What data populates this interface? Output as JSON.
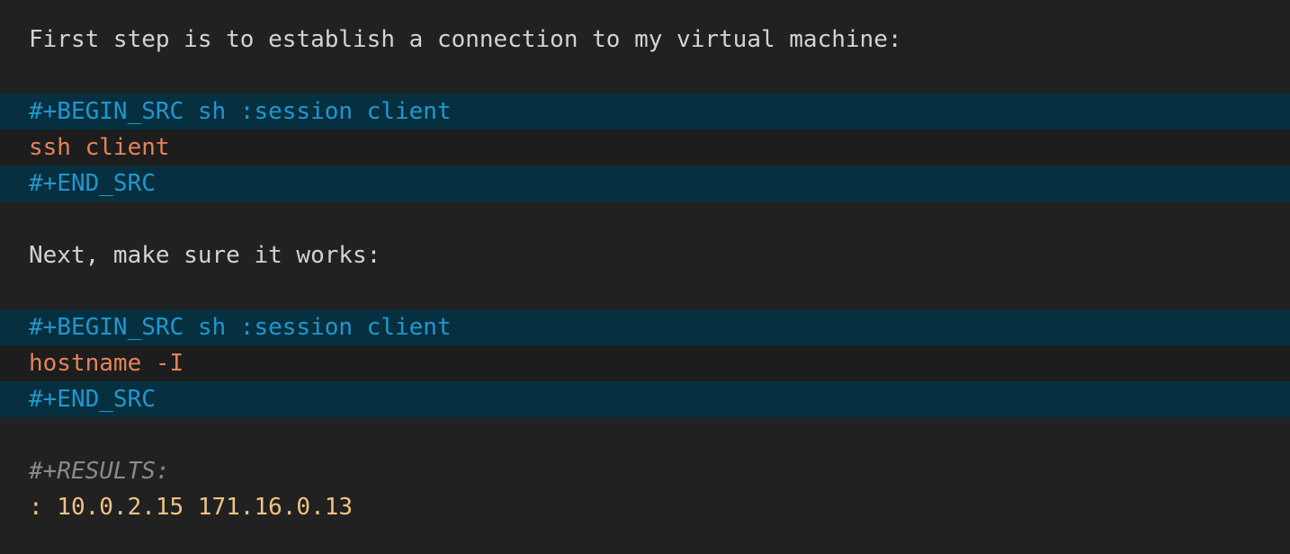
{
  "document": {
    "type": "org-mode-buffer",
    "theme": {
      "background": "#212121",
      "src_block_background": "#06303f",
      "src_body_background": "#1d1d1d",
      "prose_color": "#d3d3cf",
      "keyword_color": "#2196cf",
      "code_color": "#e5835a",
      "results_keyword_color": "#8a8a8a",
      "results_output_color": "#f0c382"
    },
    "lines": [
      {
        "id": "prose-1",
        "kind": "prose",
        "text": "First step is to establish a connection to my virtual machine:"
      },
      {
        "id": "blank-1",
        "kind": "blank",
        "text": ""
      },
      {
        "id": "begin-src-1",
        "kind": "src-delim",
        "text": "#+BEGIN_SRC sh :session client",
        "keyword": "#+BEGIN_SRC",
        "language": "sh",
        "header_args": ":session client"
      },
      {
        "id": "src-body-1",
        "kind": "src-body",
        "text": "ssh client"
      },
      {
        "id": "end-src-1",
        "kind": "src-delim",
        "text": "#+END_SRC",
        "keyword": "#+END_SRC"
      },
      {
        "id": "blank-2",
        "kind": "blank",
        "text": ""
      },
      {
        "id": "prose-2",
        "kind": "prose",
        "text": "Next, make sure it works:"
      },
      {
        "id": "blank-3",
        "kind": "blank",
        "text": ""
      },
      {
        "id": "begin-src-2",
        "kind": "src-delim",
        "text": "#+BEGIN_SRC sh :session client",
        "keyword": "#+BEGIN_SRC",
        "language": "sh",
        "header_args": ":session client"
      },
      {
        "id": "src-body-2",
        "kind": "src-body",
        "text": "hostname -I"
      },
      {
        "id": "end-src-2",
        "kind": "src-delim",
        "text": "#+END_SRC",
        "keyword": "#+END_SRC"
      },
      {
        "id": "blank-4",
        "kind": "blank",
        "text": ""
      },
      {
        "id": "results-keyword",
        "kind": "results-kw",
        "text": "#+RESULTS:"
      },
      {
        "id": "results-output",
        "kind": "results-out",
        "text": ": 10.0.2.15 171.16.0.13",
        "addresses": [
          "10.0.2.15",
          "171.16.0.13"
        ]
      }
    ]
  }
}
